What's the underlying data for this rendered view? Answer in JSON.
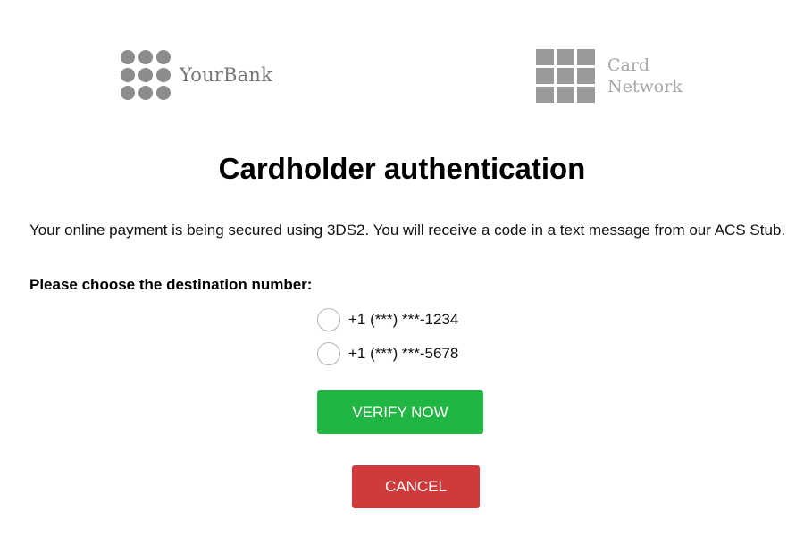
{
  "header": {
    "bank_name": "YourBank",
    "bank_logo_icon": "dot-grid-icon",
    "network_name_line1": "Card",
    "network_name_line2": "Network",
    "network_logo_icon": "square-grid-icon"
  },
  "main": {
    "title": "Cardholder authentication",
    "description": "Your online payment is being secured using 3DS2. You will receive a code in a text message from our ACS Stub.",
    "choose_label": "Please choose the destination number:",
    "phone_options": [
      {
        "label": "+1 (***) ***-1234",
        "selected": false
      },
      {
        "label": "+1 (***) ***-5678",
        "selected": false
      }
    ]
  },
  "actions": {
    "verify_label": "VERIFY NOW",
    "cancel_label": "CANCEL"
  },
  "colors": {
    "verify": "#21b543",
    "cancel": "#d03a3a",
    "logo_gray": "#8c8c8c"
  }
}
